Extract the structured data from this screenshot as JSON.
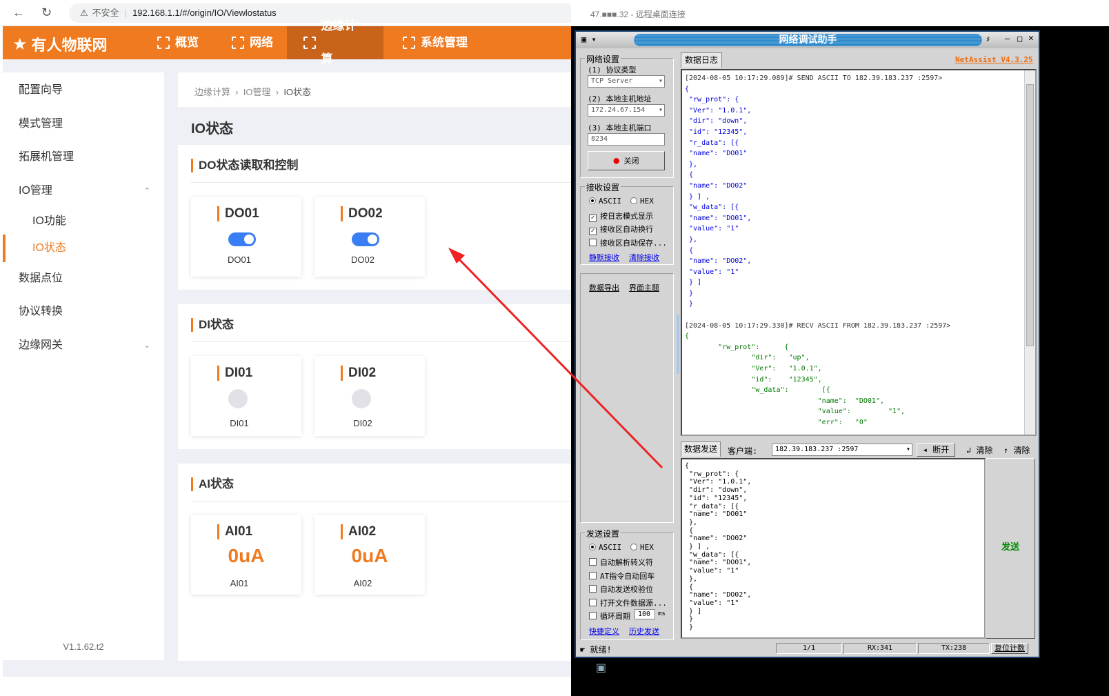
{
  "browser": {
    "security": "不安全",
    "url": "192.168.1.1/#/origin/IO/Viewlostatus"
  },
  "header": {
    "logo": "有人物联网",
    "nav": [
      "概览",
      "网络",
      "边缘计算",
      "系统管理"
    ],
    "active": "边缘计算"
  },
  "sidebar": {
    "items": [
      "配置向导",
      "模式管理",
      "拓展机管理",
      "IO管理",
      "IO功能",
      "IO状态",
      "数据点位",
      "协议转换",
      "边缘网关"
    ],
    "version": "V1.1.62.t2"
  },
  "breadcrumb": [
    "边缘计算",
    "IO管理",
    "IO状态"
  ],
  "page_title": "IO状态",
  "do_section": {
    "title": "DO状态读取和控制",
    "cards": [
      {
        "name": "DO01",
        "label": "DO01",
        "on": true
      },
      {
        "name": "DO02",
        "label": "DO02",
        "on": true
      }
    ]
  },
  "di_section": {
    "title": "DI状态",
    "cards": [
      {
        "name": "DI01",
        "label": "DI01"
      },
      {
        "name": "DI02",
        "label": "DI02"
      }
    ]
  },
  "ai_section": {
    "title": "AI状态",
    "cards": [
      {
        "name": "AI01",
        "value": "0uA",
        "label": "AI01"
      },
      {
        "name": "AI02",
        "value": "0uA",
        "label": "AI02"
      }
    ]
  },
  "remote": {
    "title": "47.■■■.32 - 远程桌面连接"
  },
  "netassist": {
    "title": "网络调试助手",
    "version": "NetAssist V4.3.25",
    "net": {
      "group": "网络设置",
      "proto_label": "(1) 协议类型",
      "proto": "TCP Server",
      "host_label": "(2) 本地主机地址",
      "host": "172.24.67.154",
      "port_label": "(3) 本地主机端口",
      "port": "8234",
      "close": "关闭"
    },
    "recv": {
      "group": "接收设置",
      "ascii": "ASCII",
      "hex": "HEX",
      "opts": [
        "按日志模式显示",
        "接收区自动换行",
        "接收区自动保存..."
      ],
      "checked": [
        true,
        true,
        false
      ],
      "links": [
        "静默接收",
        "清除接收"
      ]
    },
    "extra_links": [
      "数据导出",
      "界面主题"
    ],
    "send": {
      "group": "发送设置",
      "ascii": "ASCII",
      "hex": "HEX",
      "opts": [
        "自动解析转义符",
        "AT指令自动回车",
        "自动发送校验位",
        "打开文件数据源...",
        "循环周期"
      ],
      "period": "100",
      "unit": "ms",
      "links": [
        "快捷定义",
        "历史发送"
      ]
    },
    "log_tab": "数据日志",
    "log": [
      {
        "c": "h",
        "t": "[2024-08-05 10:17:29.089]# SEND ASCII TO 182.39.183.237 :2597>"
      },
      {
        "c": "s",
        "t": "{"
      },
      {
        "c": "s",
        "t": " \"rw_prot\": {"
      },
      {
        "c": "s",
        "t": " \"Ver\": \"1.0.1\","
      },
      {
        "c": "s",
        "t": " \"dir\": \"down\","
      },
      {
        "c": "s",
        "t": " \"id\": \"12345\","
      },
      {
        "c": "s",
        "t": " \"r_data\": [{"
      },
      {
        "c": "s",
        "t": " \"name\": \"DO01\""
      },
      {
        "c": "s",
        "t": " },"
      },
      {
        "c": "s",
        "t": " {"
      },
      {
        "c": "s",
        "t": " \"name\": \"DO02\""
      },
      {
        "c": "s",
        "t": " } ] ,"
      },
      {
        "c": "s",
        "t": " \"w_data\": [{"
      },
      {
        "c": "s",
        "t": " \"name\": \"DO01\","
      },
      {
        "c": "s",
        "t": " \"value\": \"1\""
      },
      {
        "c": "s",
        "t": " },"
      },
      {
        "c": "s",
        "t": " {"
      },
      {
        "c": "s",
        "t": " \"name\": \"DO02\","
      },
      {
        "c": "s",
        "t": " \"value\": \"1\""
      },
      {
        "c": "s",
        "t": " } ]"
      },
      {
        "c": "s",
        "t": " }"
      },
      {
        "c": "s",
        "t": " }"
      },
      {
        "c": "h",
        "t": " "
      },
      {
        "c": "h",
        "t": "[2024-08-05 10:17:29.330]# RECV ASCII FROM 182.39.183.237 :2597>"
      },
      {
        "c": "r",
        "t": "{"
      },
      {
        "c": "r",
        "t": "        \"rw_prot\":      {"
      },
      {
        "c": "r",
        "t": "                \"dir\":   \"up\","
      },
      {
        "c": "r",
        "t": "                \"Ver\":   \"1.0.1\","
      },
      {
        "c": "r",
        "t": "                \"id\":    \"12345\","
      },
      {
        "c": "r",
        "t": "                \"w_data\":        [{"
      },
      {
        "c": "r",
        "t": "                                \"name\":  \"DO01\","
      },
      {
        "c": "r",
        "t": "                                \"value\":         \"1\","
      },
      {
        "c": "r",
        "t": "                                \"err\":   \"0\""
      }
    ],
    "send_tab": "数据发送",
    "client_label": "客户端:",
    "client": "182.39.183.237 :2597",
    "disconnect": "断开",
    "clear1": "清除",
    "clear2": "清除",
    "send_text": [
      "{",
      " \"rw_prot\": {",
      " \"Ver\": \"1.0.1\",",
      " \"dir\": \"down\",",
      " \"id\": \"12345\",",
      " \"r_data\": [{",
      " \"name\": \"DO01\"",
      " },",
      " {",
      " \"name\": \"DO02\"",
      " } ] ,",
      " \"w_data\": [{",
      " \"name\": \"DO01\",",
      " \"value\": \"1\"",
      " },",
      " {",
      " \"name\": \"DO02\",",
      " \"value\": \"1\"",
      " } ]",
      " }",
      " }"
    ],
    "send_button": "发送",
    "status": {
      "ready": "就绪!",
      "page": "1/1",
      "rx": "RX:341",
      "tx": "TX:238",
      "reset": "复位计数"
    }
  }
}
